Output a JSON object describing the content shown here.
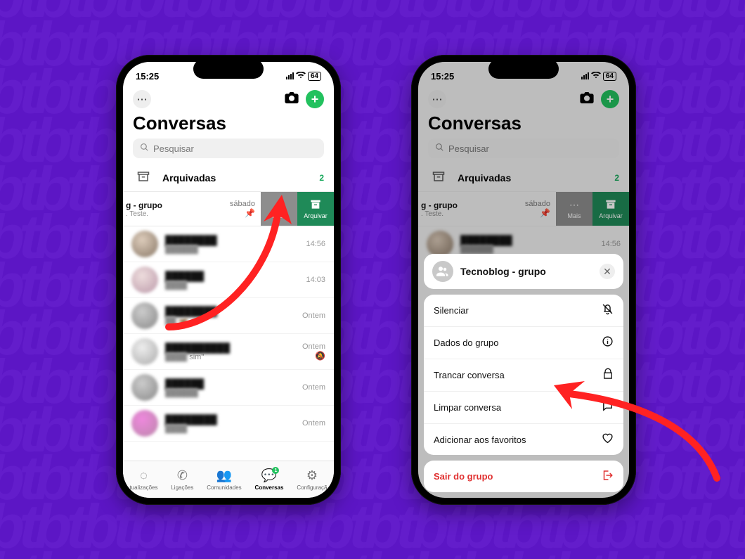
{
  "status": {
    "time": "15:25",
    "battery": "64"
  },
  "header": {
    "title": "Conversas"
  },
  "search": {
    "placeholder": "Pesquisar"
  },
  "archived": {
    "label": "Arquivadas",
    "count": "2"
  },
  "swipe": {
    "name": "g - grupo",
    "subtitle": ". Teste.",
    "time": "sábado",
    "more_label": "Mais",
    "archive_label": "Arquivar"
  },
  "tabs": {
    "updates": "tualizações",
    "calls": "Ligações",
    "communities": "Comunidades",
    "chats": "Conversas",
    "settings": "Configuraçã",
    "chats_badge": "1"
  },
  "chats": [
    {
      "time": "14:56"
    },
    {
      "time": "14:03"
    },
    {
      "time": "Ontem"
    },
    {
      "time": "Ontem",
      "snippet": "sim\""
    },
    {
      "time": "Ontem"
    },
    {
      "time": "Ontem"
    }
  ],
  "sheet": {
    "group_name": "Tecnoblog - grupo",
    "items": {
      "mute": "Silenciar",
      "group_data": "Dados do grupo",
      "lock": "Trancar conversa",
      "clear": "Limpar conversa",
      "fav": "Adicionar aos favoritos"
    },
    "leave": "Sair do grupo"
  }
}
